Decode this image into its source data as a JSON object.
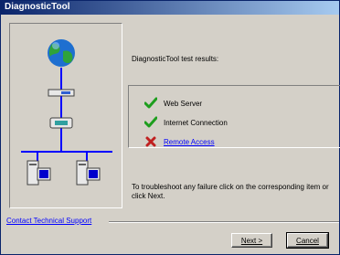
{
  "window": {
    "title": "DiagnosticTool"
  },
  "results": {
    "heading": "DiagnosticTool test results:",
    "items": [
      {
        "label": "Web Server",
        "status": "pass",
        "icon": "green-check-icon",
        "link": false
      },
      {
        "label": "Internet Connection",
        "status": "pass",
        "icon": "green-check-icon",
        "link": false
      },
      {
        "label": "Remote Access",
        "status": "fail",
        "icon": "red-x-icon",
        "link": true
      }
    ]
  },
  "hint": "To troubleshoot any failure click on the corresponding item or click Next.",
  "footer": {
    "support_link": "Contact Technical Support",
    "next_label": "Next >",
    "cancel_label": "Cancel"
  },
  "colors": {
    "link": "#0000ff",
    "pass": "#1e9e1e",
    "fail": "#c02020",
    "titlebar": "#0a246a",
    "network_line": "#0000ff"
  }
}
